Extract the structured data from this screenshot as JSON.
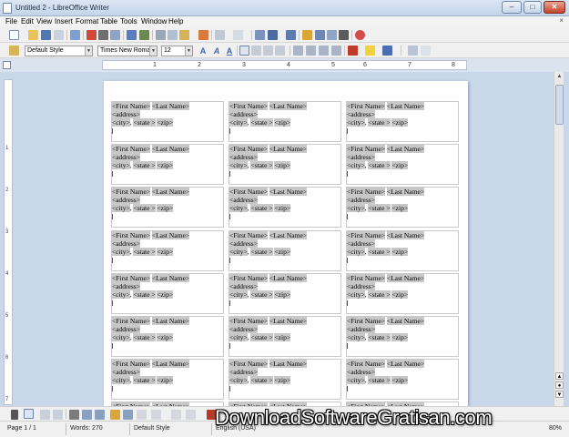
{
  "window": {
    "title": "Untitled 2 - LibreOffice Writer",
    "minimize": "–",
    "maximize": "□",
    "close": "✕"
  },
  "menu": [
    "File",
    "Edit",
    "View",
    "Insert",
    "Format",
    "Table",
    "Tools",
    "Window",
    "Help"
  ],
  "menu_close": "×",
  "formatting": {
    "paragraph_style": "Default Style",
    "font_name": "Times New Roman",
    "font_size": "12"
  },
  "ruler_labels": [
    "1",
    "2",
    "3",
    "4",
    "5",
    "6",
    "7",
    "8"
  ],
  "vruler_labels": [
    "1",
    "2",
    "3",
    "4",
    "5",
    "6",
    "7"
  ],
  "labels": {
    "rows": 8,
    "cols": 3,
    "line1": {
      "first_name": "<First Name>",
      "last_name": "<Last Name>"
    },
    "line2": {
      "address": "<address>"
    },
    "line3": {
      "city": "<city>",
      "comma": ",",
      "state": "<state >",
      "zip": "<zip>"
    }
  },
  "status": {
    "page": "Page 1 / 1",
    "words": "Words: 270",
    "style": "Default Style",
    "language": "English (USA)",
    "zoom": "80%"
  },
  "watermark": "DownloadSoftwareGratisan.com",
  "colors": {
    "titlebar": "#c3d3ea",
    "field_shade": "#c8c8c8",
    "doc_background": "#c9d7ea"
  }
}
